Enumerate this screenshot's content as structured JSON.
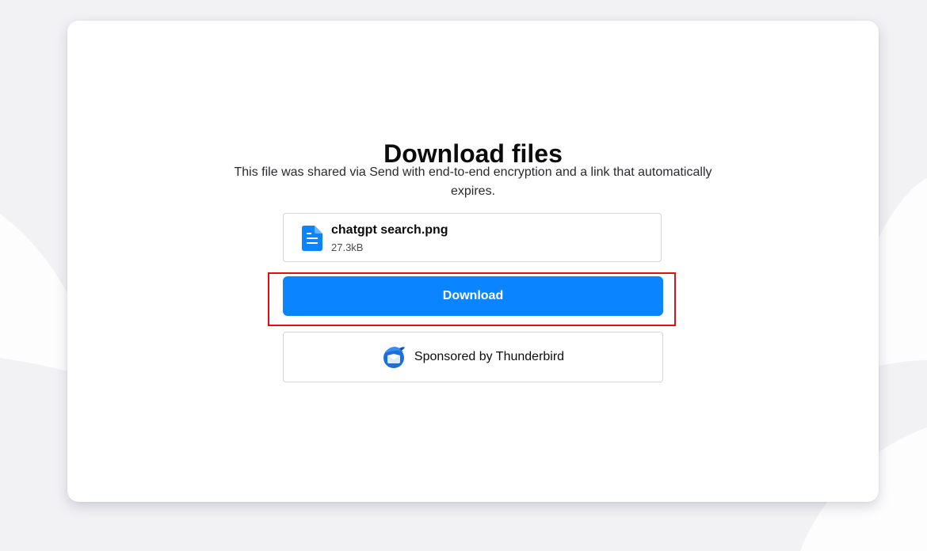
{
  "page": {
    "title": "Download files",
    "description": "This file was shared via Send with end-to-end encryption and a link that automatically expires."
  },
  "file": {
    "icon": "document-icon",
    "name": "chatgpt search.png",
    "size": "27.3kB"
  },
  "download": {
    "label": "Download"
  },
  "sponsor": {
    "icon": "thunderbird-logo-icon",
    "label": "Sponsored by Thunderbird"
  },
  "colors": {
    "accent": "#0a84ff",
    "highlight": "#e01010",
    "background": "#f2f2f5",
    "card": "#ffffff"
  }
}
